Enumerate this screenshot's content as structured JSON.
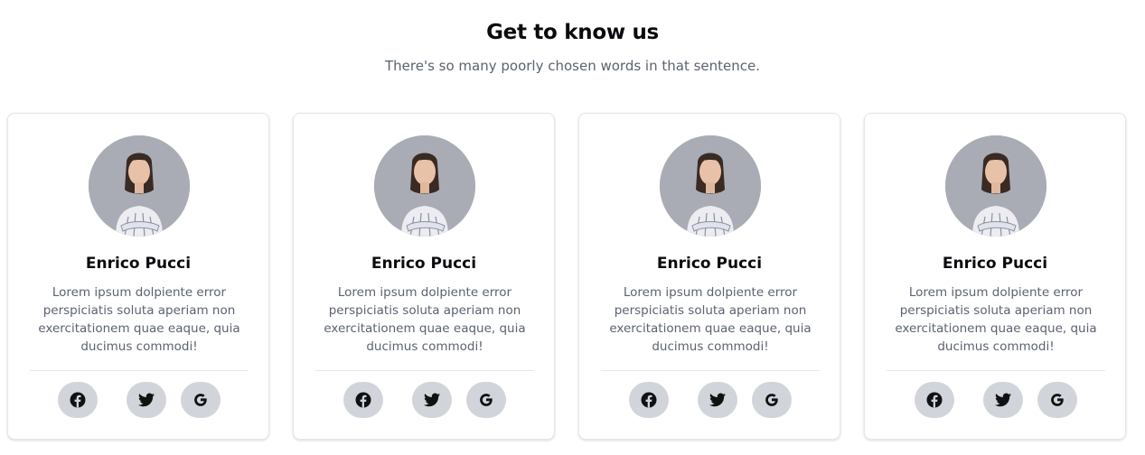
{
  "header": {
    "title": "Get to know us",
    "subtitle": "There's so many poorly chosen words in that sentence."
  },
  "members": [
    {
      "name": "Enrico Pucci",
      "bio": "Lorem ipsum dolpiente error perspiciatis soluta aperiam non exercitationem quae eaque, quia ducimus commodi!",
      "social": [
        "facebook-icon",
        "twitter-icon",
        "google-icon"
      ]
    },
    {
      "name": "Enrico Pucci",
      "bio": "Lorem ipsum dolpiente error perspiciatis soluta aperiam non exercitationem quae eaque, quia ducimus commodi!",
      "social": [
        "facebook-icon",
        "twitter-icon",
        "google-icon"
      ]
    },
    {
      "name": "Enrico Pucci",
      "bio": "Lorem ipsum dolpiente error perspiciatis soluta aperiam non exercitationem quae eaque, quia ducimus commodi!",
      "social": [
        "facebook-icon",
        "twitter-icon",
        "google-icon"
      ]
    },
    {
      "name": "Enrico Pucci",
      "bio": "Lorem ipsum dolpiente error perspiciatis soluta aperiam non exercitationem quae eaque, quia ducimus commodi!",
      "social": [
        "facebook-icon",
        "twitter-icon",
        "google-icon"
      ]
    }
  ],
  "colors": {
    "title": "#0b0b0f",
    "muted_text": "#5b6270",
    "social_button_bg": "#d1d5db",
    "card_border": "#e5e7eb",
    "avatar_bg": "#a9acb4"
  }
}
